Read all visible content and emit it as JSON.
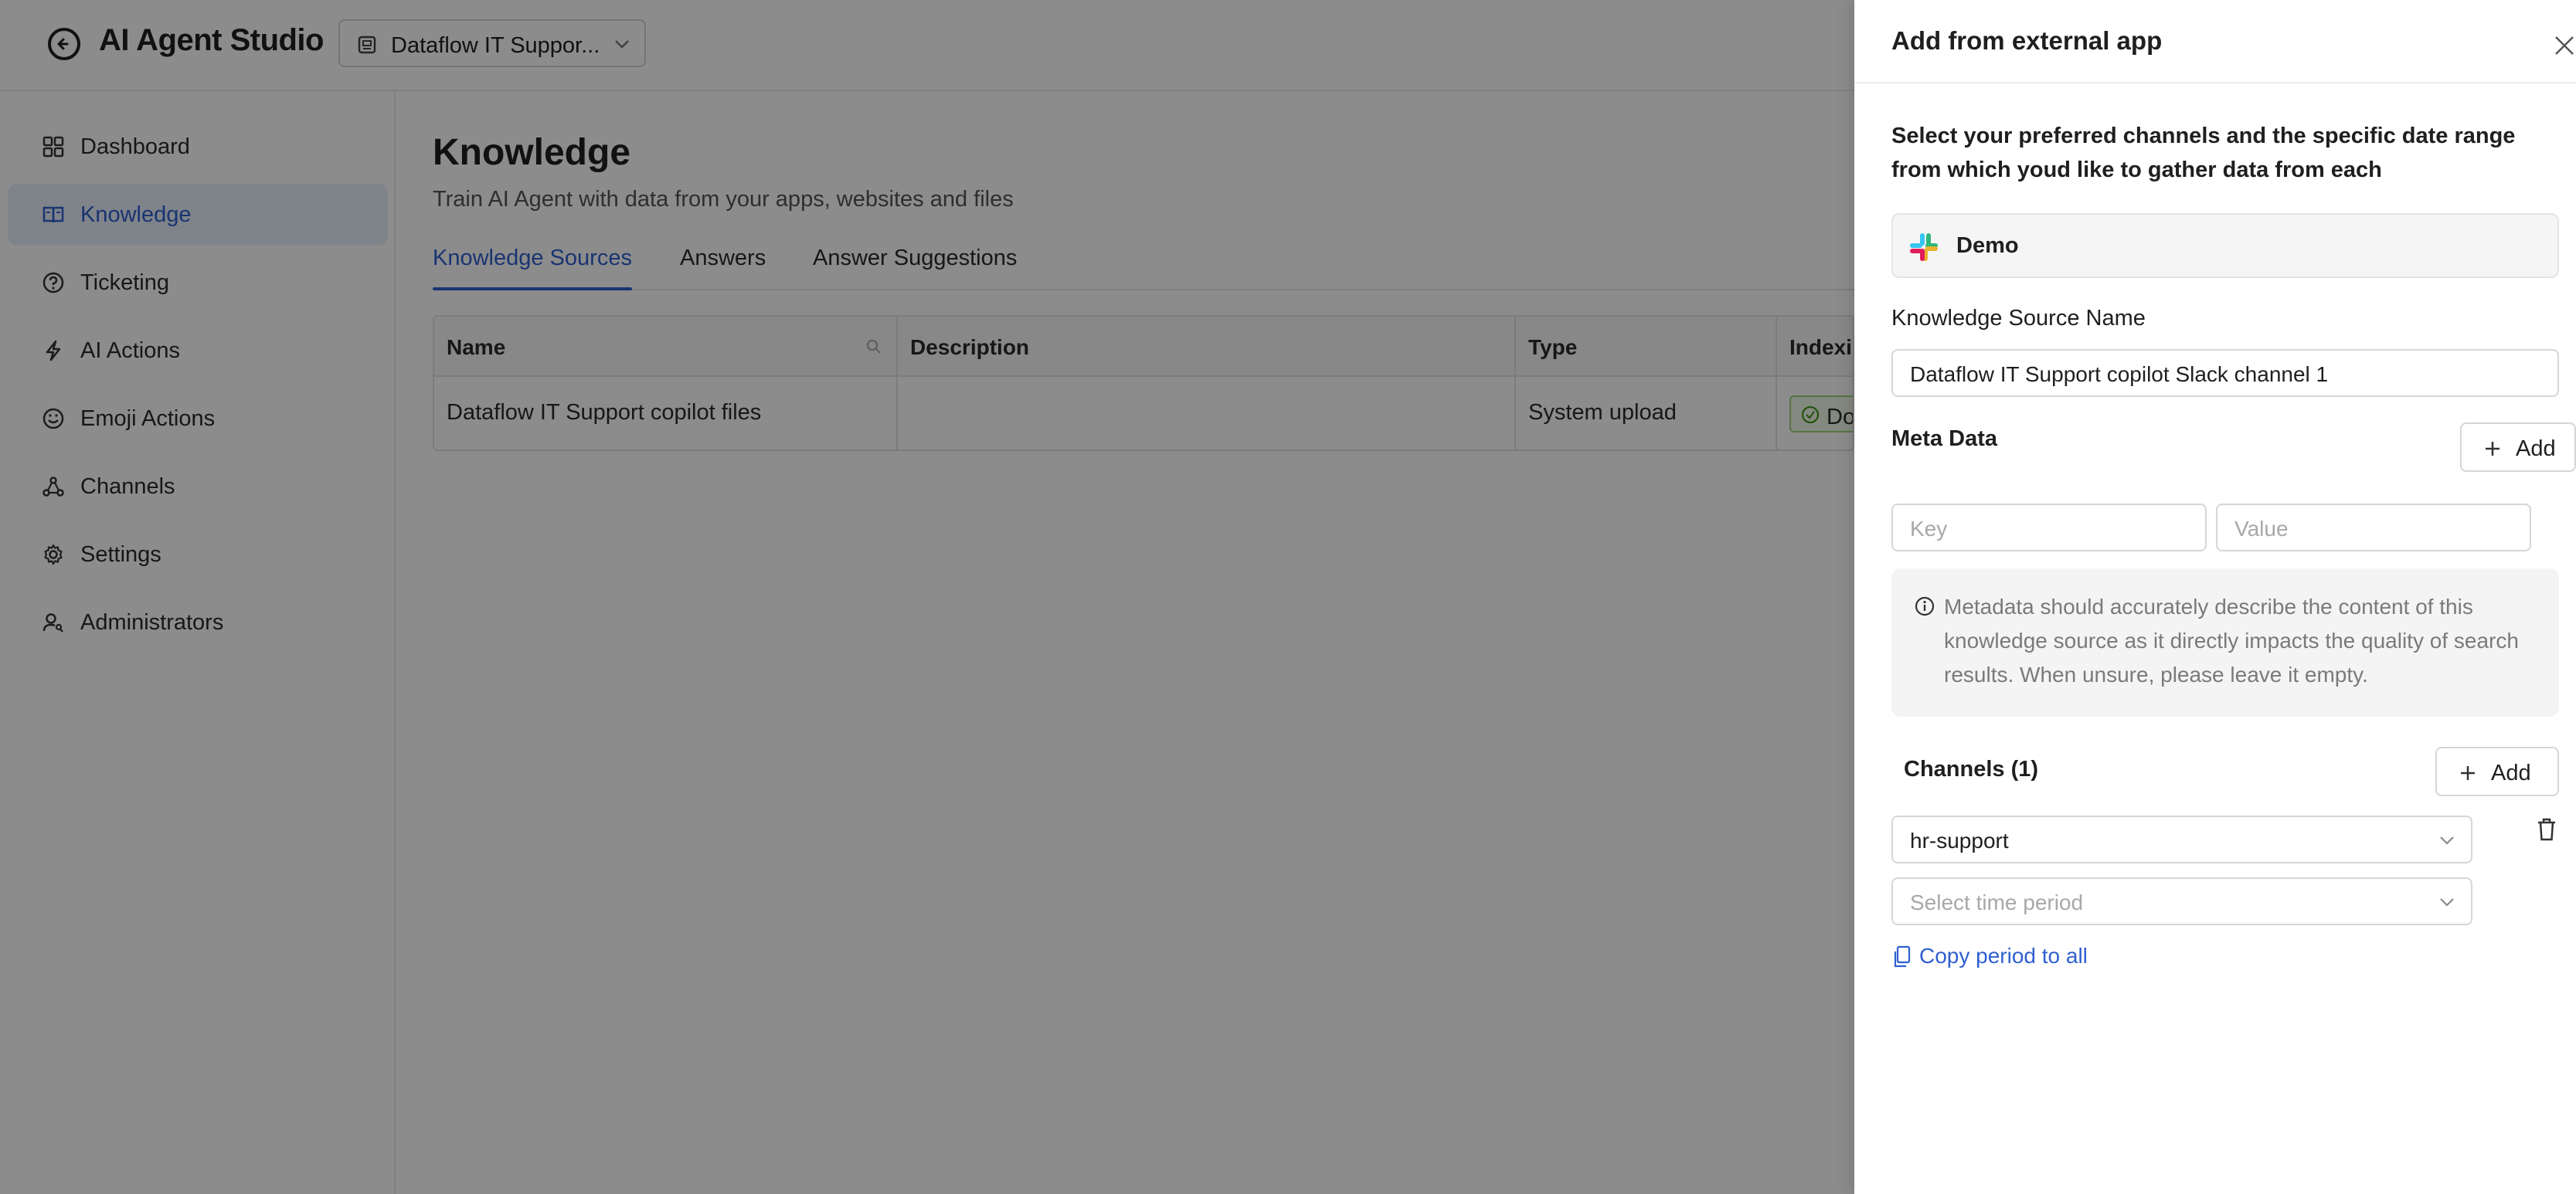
{
  "app": {
    "title": "AI Agent Studio",
    "workspace": "Dataflow IT Suppor..."
  },
  "sidebar": {
    "items": [
      {
        "label": "Dashboard",
        "icon": "grid-icon"
      },
      {
        "label": "Knowledge",
        "icon": "book-icon",
        "active": true
      },
      {
        "label": "Ticketing",
        "icon": "question-circle-icon"
      },
      {
        "label": "AI Actions",
        "icon": "lightning-icon"
      },
      {
        "label": "Emoji Actions",
        "icon": "smile-icon"
      },
      {
        "label": "Channels",
        "icon": "network-icon"
      },
      {
        "label": "Settings",
        "icon": "gear-icon"
      },
      {
        "label": "Administrators",
        "icon": "user-key-icon"
      }
    ]
  },
  "main": {
    "title": "Knowledge",
    "subtitle": "Train AI Agent with data from your apps, websites and files",
    "tabs": [
      {
        "label": "Knowledge Sources",
        "active": true
      },
      {
        "label": "Answers"
      },
      {
        "label": "Answer Suggestions"
      }
    ],
    "table": {
      "columns": [
        "Name",
        "Description",
        "Type",
        "Indexi"
      ],
      "rows": [
        {
          "name": "Dataflow IT Support copilot files",
          "description": "",
          "type": "System upload",
          "status": "Do"
        }
      ]
    }
  },
  "drawer": {
    "title": "Add from external app",
    "intro": "Select your preferred channels and the specific date range from which youd like to gather data from each",
    "source": {
      "name": "Demo",
      "icon": "slack-logo"
    },
    "source_name_label": "Knowledge Source Name",
    "source_name_value": "Dataflow IT Support copilot Slack channel 1",
    "meta_label": "Meta Data",
    "add_label": "Add",
    "key_placeholder": "Key",
    "value_placeholder": "Value",
    "info_text": "Metadata should accurately describe the content of this knowledge source as it directly impacts the quality of search results. When unsure, please leave it empty.",
    "channels_title": "Channels (1)",
    "channel_value": "hr-support",
    "time_placeholder": "Select time period",
    "copy_label": "Copy period to all"
  },
  "colors": {
    "accent": "#2f5fd0",
    "active_nav_bg": "#e8eefb",
    "success": "#3e9a1a",
    "overlay": "rgba(0,0,0,0.45)"
  }
}
